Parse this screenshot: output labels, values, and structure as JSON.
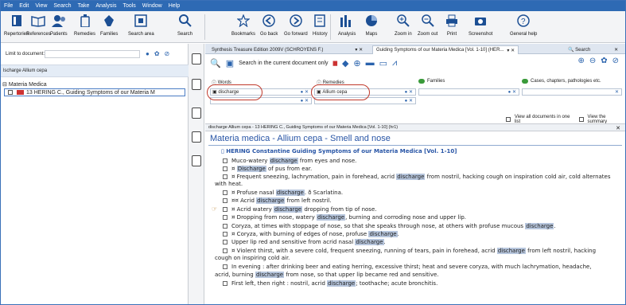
{
  "menubar": [
    "File",
    "Edit",
    "View",
    "Search",
    "Take",
    "Analysis",
    "Tools",
    "Window",
    "Help"
  ],
  "toolbar": {
    "repertories": "Repertories",
    "references": "References",
    "patients": "Patients",
    "remedies": "Remedies",
    "families": "Families",
    "search_area": "Search area",
    "search": "Search",
    "bookmarks": "Bookmarks",
    "go_back": "Go back",
    "go_forward": "Go forward",
    "history": "History",
    "analysis": "Analysis",
    "maps": "Maps",
    "zoom_in": "Zoom in",
    "zoom_out": "Zoom out",
    "print": "Print",
    "screenshot": "Screenshot",
    "general_help": "General help"
  },
  "left": {
    "limit_label": "Limit to document:",
    "strip_text": "lscharge Allium cepa",
    "tree_root": "Materia Medica",
    "tree_item": "13 HERING C., Guiding Symptoms of our Materia M"
  },
  "tabs": [
    {
      "label": "Synthesis Treasure Edition 2009V (SCHROYENS F.)"
    },
    {
      "label": "Guiding Symptoms of our Materia Medica [Vol. 1-10] (HER..."
    },
    {
      "label": "Search"
    }
  ],
  "search": {
    "scope_label": "Search in the current document only",
    "words_label": "Words",
    "remedies_label": "Remedies",
    "families_label": "Families",
    "cases_label": "Cases, chapters, pathologies etc.",
    "words_value": "discharge",
    "remedies_value": "Allium cepa",
    "view_all": "View all documents in one list",
    "view_summary": "View the summary"
  },
  "doc": {
    "path": "discharge Allium cepa - 13 HERING C., Guiding Symptoms of our Materia Medica [Vol. 1-10] (hr1)",
    "title": "Materia medica - Allium cepa - Smell and nose",
    "book": "HERING Constantine Guiding Symptoms of our Materia Medica [Vol. 1-10]",
    "lines": [
      [
        "Muco-watery ",
        "discharge",
        " from eyes and nose.",
        ""
      ],
      [
        "¤ ",
        "Discharge",
        " of pus from ear.",
        ""
      ],
      [
        "¤ Frequent sneezing, lachrymation, pain in forehead, acrid ",
        "discharge",
        " from nostril, hacking cough on inspiration cold air, cold alternates",
        ""
      ],
      [
        "with heat.",
        "",
        "",
        ""
      ],
      [
        "¤ Profuse nasal ",
        "discharge",
        ". ð Scarlatina.",
        ""
      ],
      [
        "¤¤ Acrid ",
        "discharge",
        " from left nostril.",
        ""
      ],
      [
        "¤ Acrid watery ",
        "discharge",
        " dropping from tip of nose.",
        ""
      ],
      [
        "¤ Dropping from nose, watery ",
        "discharge",
        ", burning and corroding nose and upper lip.",
        ""
      ],
      [
        "Coryza, at times with stoppage of nose, so that she speaks through nose, at others with profuse mucous ",
        "discharge",
        ".",
        ""
      ],
      [
        "¤ Coryza, with burning of edges of nose, profuse ",
        "discharge",
        ".",
        ""
      ],
      [
        "Upper lip red and sensitive from acrid nasal ",
        "discharge",
        ".",
        ""
      ],
      [
        "¤ Violent thirst, with a severe cold, frequent sneezing, running of tears, pain in forehead, acrid ",
        "discharge",
        " from left nostril, hacking",
        ""
      ],
      [
        "cough on inspiring cold air.",
        "",
        "",
        ""
      ],
      [
        "In evening : after drinking beer and eating herring, excessive thirst; heat and severe coryza, with much lachrymation, headache,",
        "",
        "",
        ""
      ],
      [
        "acrid, burning ",
        "discharge",
        " from nose, so that upper lip became red and sensitive.",
        ""
      ],
      [
        "First left, then right : nostril, acrid ",
        "discharge",
        "; toothache; acute bronchitis.",
        ""
      ]
    ]
  },
  "colors": {
    "accent": "#2e6ab4",
    "highlight": "#b7c6dd",
    "oval": "#c0392b"
  }
}
